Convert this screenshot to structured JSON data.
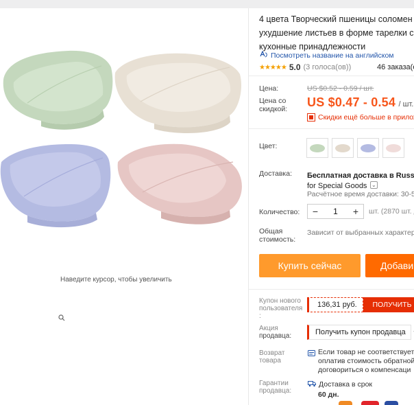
{
  "gallery": {
    "zoom_hint": "Наведите курсор, чтобы увеличить",
    "swatch_colors": {
      "green": "#c6dbbf",
      "beige": "#ece4d9",
      "blue": "#b7bde3",
      "pink": "#e8c9c7"
    }
  },
  "product": {
    "title_lines": [
      "4 цвета Творческий пшеницы соломен",
      "ухудшение листьев в форме тарелки с",
      "кухонные принадлежности"
    ],
    "translate_link": "Посмотреть название на английском",
    "stars": "★★★★★",
    "rating": "5.0",
    "votes": "(3 голоса(ов))",
    "orders": "46 заказа(о"
  },
  "pricing": {
    "price_label": "Цена:",
    "old_price": "US $0.52 - 0.59 / шт.",
    "discount_label_line1": "Цена со",
    "discount_label_line2": "скидкой:",
    "price": "US $0.47 - 0.54",
    "per_unit": "/ шт.",
    "promo": "Скидки ещё больше в прилож"
  },
  "options": {
    "color_label": "Цвет:",
    "shipping_label": "Доставка:",
    "shipping_main": "Бесплатная доставка",
    "shipping_to": " в Russian",
    "shipping_service": "for Special Goods",
    "shipping_time": "Расчётное время доставки: 30-5",
    "quantity_label": "Количество:",
    "quantity_minus": "−",
    "quantity_value": "1",
    "quantity_plus": "+",
    "quantity_note": "шт. (2870 шт. д",
    "total_label_line1": "Общая",
    "total_label_line2": "стоимость:",
    "total_value": "Зависит от выбранных характер"
  },
  "actions": {
    "buy_now": "Купить сейчас",
    "add_to_cart": "Добави"
  },
  "extras": {
    "new_user_label": [
      "Купон нового",
      "пользователя",
      ":"
    ],
    "coupon_amount": "136,31 руб.",
    "coupon_get": "ПОЛУЧИТЬ",
    "seller_promo_label": [
      "Акция",
      "продавца:"
    ],
    "seller_coupon": "Получить купон продавца",
    "return_label": [
      "Возврат",
      "товара"
    ],
    "return_text": [
      "Если товар не соответствует",
      "оплатив стоимость обратной",
      "договориться о компенсаци"
    ],
    "guarantee_label": [
      "Гарантии",
      "продавца:"
    ],
    "guarantee_text": "Доставка в срок",
    "guarantee_days": "60 дн."
  }
}
